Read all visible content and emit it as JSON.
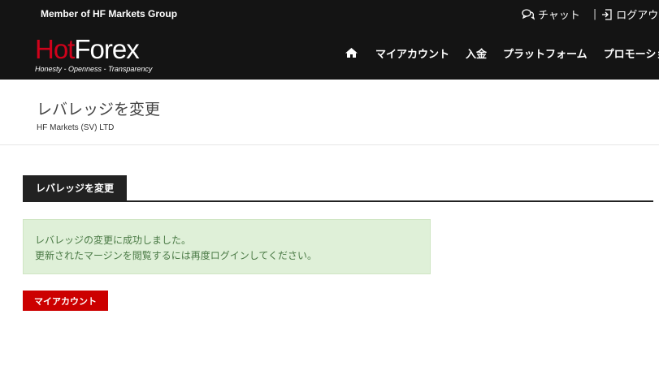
{
  "header": {
    "member_text": "Member of HF Markets Group",
    "chat_label": "チャット",
    "separator": "|",
    "logout_label": "ログアウト",
    "logo": {
      "hot": "Hot",
      "forex": "Forex",
      "tagline": "Honesty - Openness - Transparency"
    },
    "nav": {
      "home_icon": "home-icon",
      "items": [
        "マイアカウント",
        "入金",
        "プラットフォーム",
        "プロモーション"
      ]
    }
  },
  "page": {
    "title": "レバレッジを変更",
    "company": "HF Markets (SV) LTD"
  },
  "tab": {
    "label": "レバレッジを変更"
  },
  "alert": {
    "line1": "レバレッジの変更に成功しました。",
    "line2": "更新されたマージンを閲覧するには再度ログインしてください。"
  },
  "button": {
    "label": "マイアカウント"
  },
  "colors": {
    "header_bg": "#141414",
    "brand_red": "#d0021b",
    "button_red": "#cc0000",
    "alert_bg": "#dff0d8",
    "alert_text": "#4a7a45"
  }
}
